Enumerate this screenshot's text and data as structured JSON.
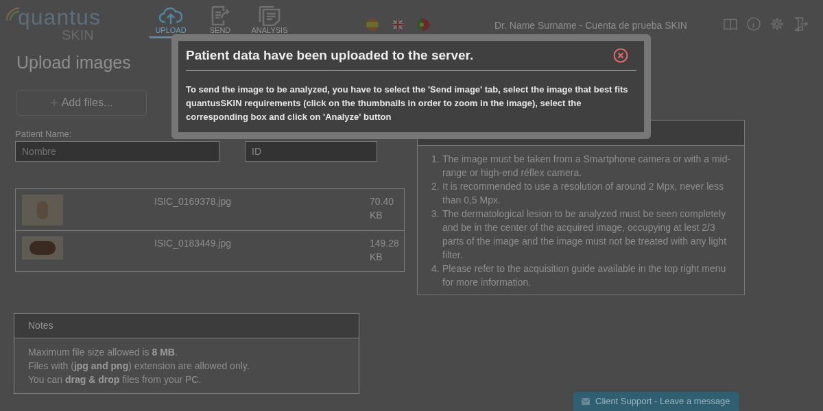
{
  "header": {
    "logo": {
      "wordmark": "quantus",
      "product": "SKIN"
    },
    "tabs": [
      {
        "kind": "upload",
        "label": "UPLOAD",
        "selected": true
      },
      {
        "kind": "send",
        "label": "SEND",
        "selected": false
      },
      {
        "kind": "analysis",
        "label": "ANALYSIS",
        "selected": false
      }
    ],
    "languages": [
      {
        "kind": "es"
      },
      {
        "kind": "gb"
      },
      {
        "kind": "pt"
      }
    ],
    "user": "Dr. Name Surname - Cuenta de prueba SKIN"
  },
  "page_title": "Upload images",
  "add_button": "Add files...",
  "patient_name": {
    "label": "Patient Name:",
    "placeholder": "Nombre"
  },
  "patient_id": {
    "placeholder": "ID"
  },
  "files": [
    {
      "name": "ISIC_0169378.jpg",
      "size": "70.40 KB",
      "kind": "light"
    },
    {
      "name": "ISIC_0183449.jpg",
      "size": "149.28 KB",
      "kind": "dark"
    }
  ],
  "requirements": [
    {
      "number": "1.",
      "text": "The image must be taken from a Smartphone camera or with a mid-range or high-end réflex camera."
    },
    {
      "number": "2.",
      "text": "It is recommended to use a resolution of around 2 Mpx, never less than 0,5 Mpx."
    },
    {
      "number": "3.",
      "text": "The dermatological lesion to be analyzed must be seen completely and be in the center of the acquired image, occupying at lest 2/3 parts of the image and the image must not be treated with any light filter."
    },
    {
      "number": "4.",
      "text": "Please refer to the acquisition guide available in the top right menu for more information."
    }
  ],
  "notes": {
    "title": "Notes",
    "lines": [
      "Maximum file size allowed is **8 MB**.",
      "Files with (**jpg and png**) extension are allowed only.",
      "You can **drag & drop** files from your PC."
    ]
  },
  "support_button": "Client Support - Leave a message",
  "modal": {
    "title": "Patient data have been uploaded to the server.",
    "message": "To send the image to be analyzed, you have to select the 'Send image' tab, select the image that best fits quantusSKIN requirements (click on the thumbnails in order to zoom in the image), select the corresponding box and click on 'Analyze' button"
  }
}
